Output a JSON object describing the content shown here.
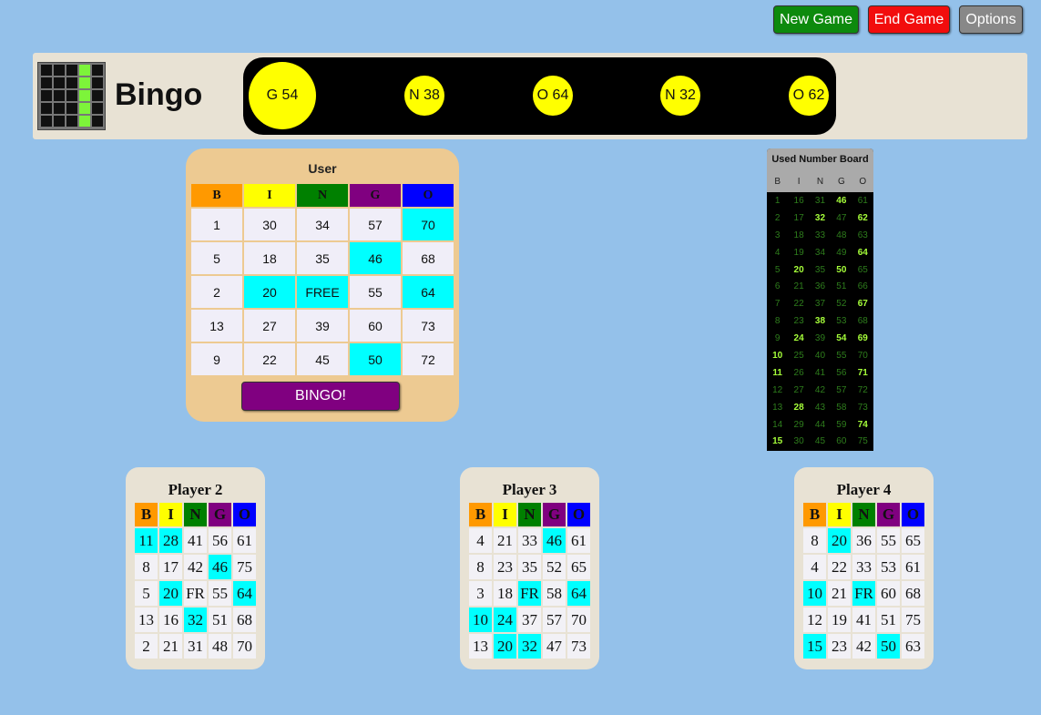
{
  "buttons": {
    "new_game": "New Game",
    "end_game": "End Game",
    "options": "Options"
  },
  "header": {
    "title": "Bingo",
    "logo_lit_cells": [
      3,
      8,
      13,
      18,
      23
    ],
    "balls": [
      "G 54",
      "N 38",
      "O 64",
      "N 32",
      "O 62"
    ]
  },
  "colors": {
    "B": "#ff9900",
    "I": "#ffff00",
    "N": "#008000",
    "G": "#800080",
    "O": "#0000ff",
    "marked": "#00ffff"
  },
  "user": {
    "title": "User",
    "headers": [
      "B",
      "I",
      "N",
      "G",
      "O"
    ],
    "rows": [
      [
        "1",
        "30",
        "34",
        "57",
        "70"
      ],
      [
        "5",
        "18",
        "35",
        "46",
        "68"
      ],
      [
        "2",
        "20",
        "FREE",
        "55",
        "64"
      ],
      [
        "13",
        "27",
        "39",
        "60",
        "73"
      ],
      [
        "9",
        "22",
        "45",
        "50",
        "72"
      ]
    ],
    "marked": [
      [
        0,
        4
      ],
      [
        1,
        3
      ],
      [
        2,
        1
      ],
      [
        2,
        2
      ],
      [
        2,
        4
      ],
      [
        4,
        3
      ]
    ],
    "bingo_label": "BINGO!"
  },
  "used_board": {
    "title": "Used Number Board",
    "headers": [
      "B",
      "I",
      "N",
      "G",
      "O"
    ],
    "called": [
      10,
      11,
      15,
      20,
      24,
      28,
      32,
      38,
      46,
      50,
      54,
      62,
      64,
      67,
      69,
      71,
      74
    ]
  },
  "players": [
    {
      "name": "Player 2",
      "headers": [
        "B",
        "I",
        "N",
        "G",
        "O"
      ],
      "rows": [
        [
          "11",
          "28",
          "41",
          "56",
          "61"
        ],
        [
          "8",
          "17",
          "42",
          "46",
          "75"
        ],
        [
          "5",
          "20",
          "FR",
          "55",
          "64"
        ],
        [
          "13",
          "16",
          "32",
          "51",
          "68"
        ],
        [
          "2",
          "21",
          "31",
          "48",
          "70"
        ]
      ],
      "marked": [
        [
          0,
          0
        ],
        [
          0,
          1
        ],
        [
          1,
          3
        ],
        [
          2,
          1
        ],
        [
          2,
          4
        ],
        [
          3,
          2
        ]
      ]
    },
    {
      "name": "Player 3",
      "headers": [
        "B",
        "I",
        "N",
        "G",
        "O"
      ],
      "rows": [
        [
          "4",
          "21",
          "33",
          "46",
          "61"
        ],
        [
          "8",
          "23",
          "35",
          "52",
          "65"
        ],
        [
          "3",
          "18",
          "FR",
          "58",
          "64"
        ],
        [
          "10",
          "24",
          "37",
          "57",
          "70"
        ],
        [
          "13",
          "20",
          "32",
          "47",
          "73"
        ]
      ],
      "marked": [
        [
          0,
          3
        ],
        [
          2,
          2
        ],
        [
          2,
          4
        ],
        [
          3,
          0
        ],
        [
          3,
          1
        ],
        [
          4,
          1
        ],
        [
          4,
          2
        ]
      ]
    },
    {
      "name": "Player 4",
      "headers": [
        "B",
        "I",
        "N",
        "G",
        "O"
      ],
      "rows": [
        [
          "8",
          "20",
          "36",
          "55",
          "65"
        ],
        [
          "4",
          "22",
          "33",
          "53",
          "61"
        ],
        [
          "10",
          "21",
          "FR",
          "60",
          "68"
        ],
        [
          "12",
          "19",
          "41",
          "51",
          "75"
        ],
        [
          "15",
          "23",
          "42",
          "50",
          "63"
        ]
      ],
      "marked": [
        [
          0,
          1
        ],
        [
          2,
          0
        ],
        [
          2,
          2
        ],
        [
          4,
          0
        ],
        [
          4,
          3
        ]
      ]
    }
  ]
}
